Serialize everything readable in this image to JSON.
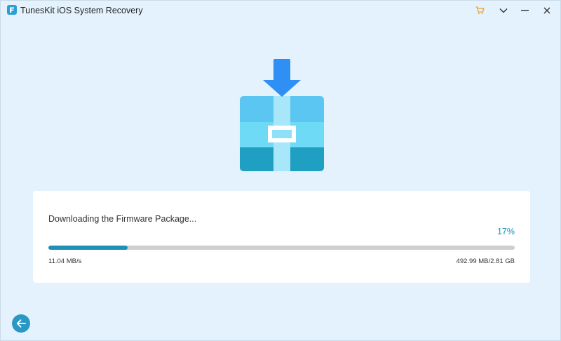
{
  "window": {
    "title": "TunesKit iOS System Recovery",
    "background": "#e3f2fc"
  },
  "titlebar": {
    "buttons": [
      {
        "name": "cart-icon"
      },
      {
        "name": "menu-chevron-icon"
      },
      {
        "name": "minimize-icon"
      },
      {
        "name": "close-icon"
      }
    ]
  },
  "hero": {
    "icon": "firmware-download-box-icon"
  },
  "download": {
    "status": "Downloading the Firmware Package...",
    "percent_label": "17%",
    "progress": 0.17,
    "speed": "11.04 MB/s",
    "size": "492.99 MB/2.81 GB"
  },
  "colors": {
    "accent": "#1e8fb5",
    "track": "#cfcfcf",
    "cart": "#f0a020"
  },
  "footer": {
    "back_icon": "back-arrow-icon"
  }
}
